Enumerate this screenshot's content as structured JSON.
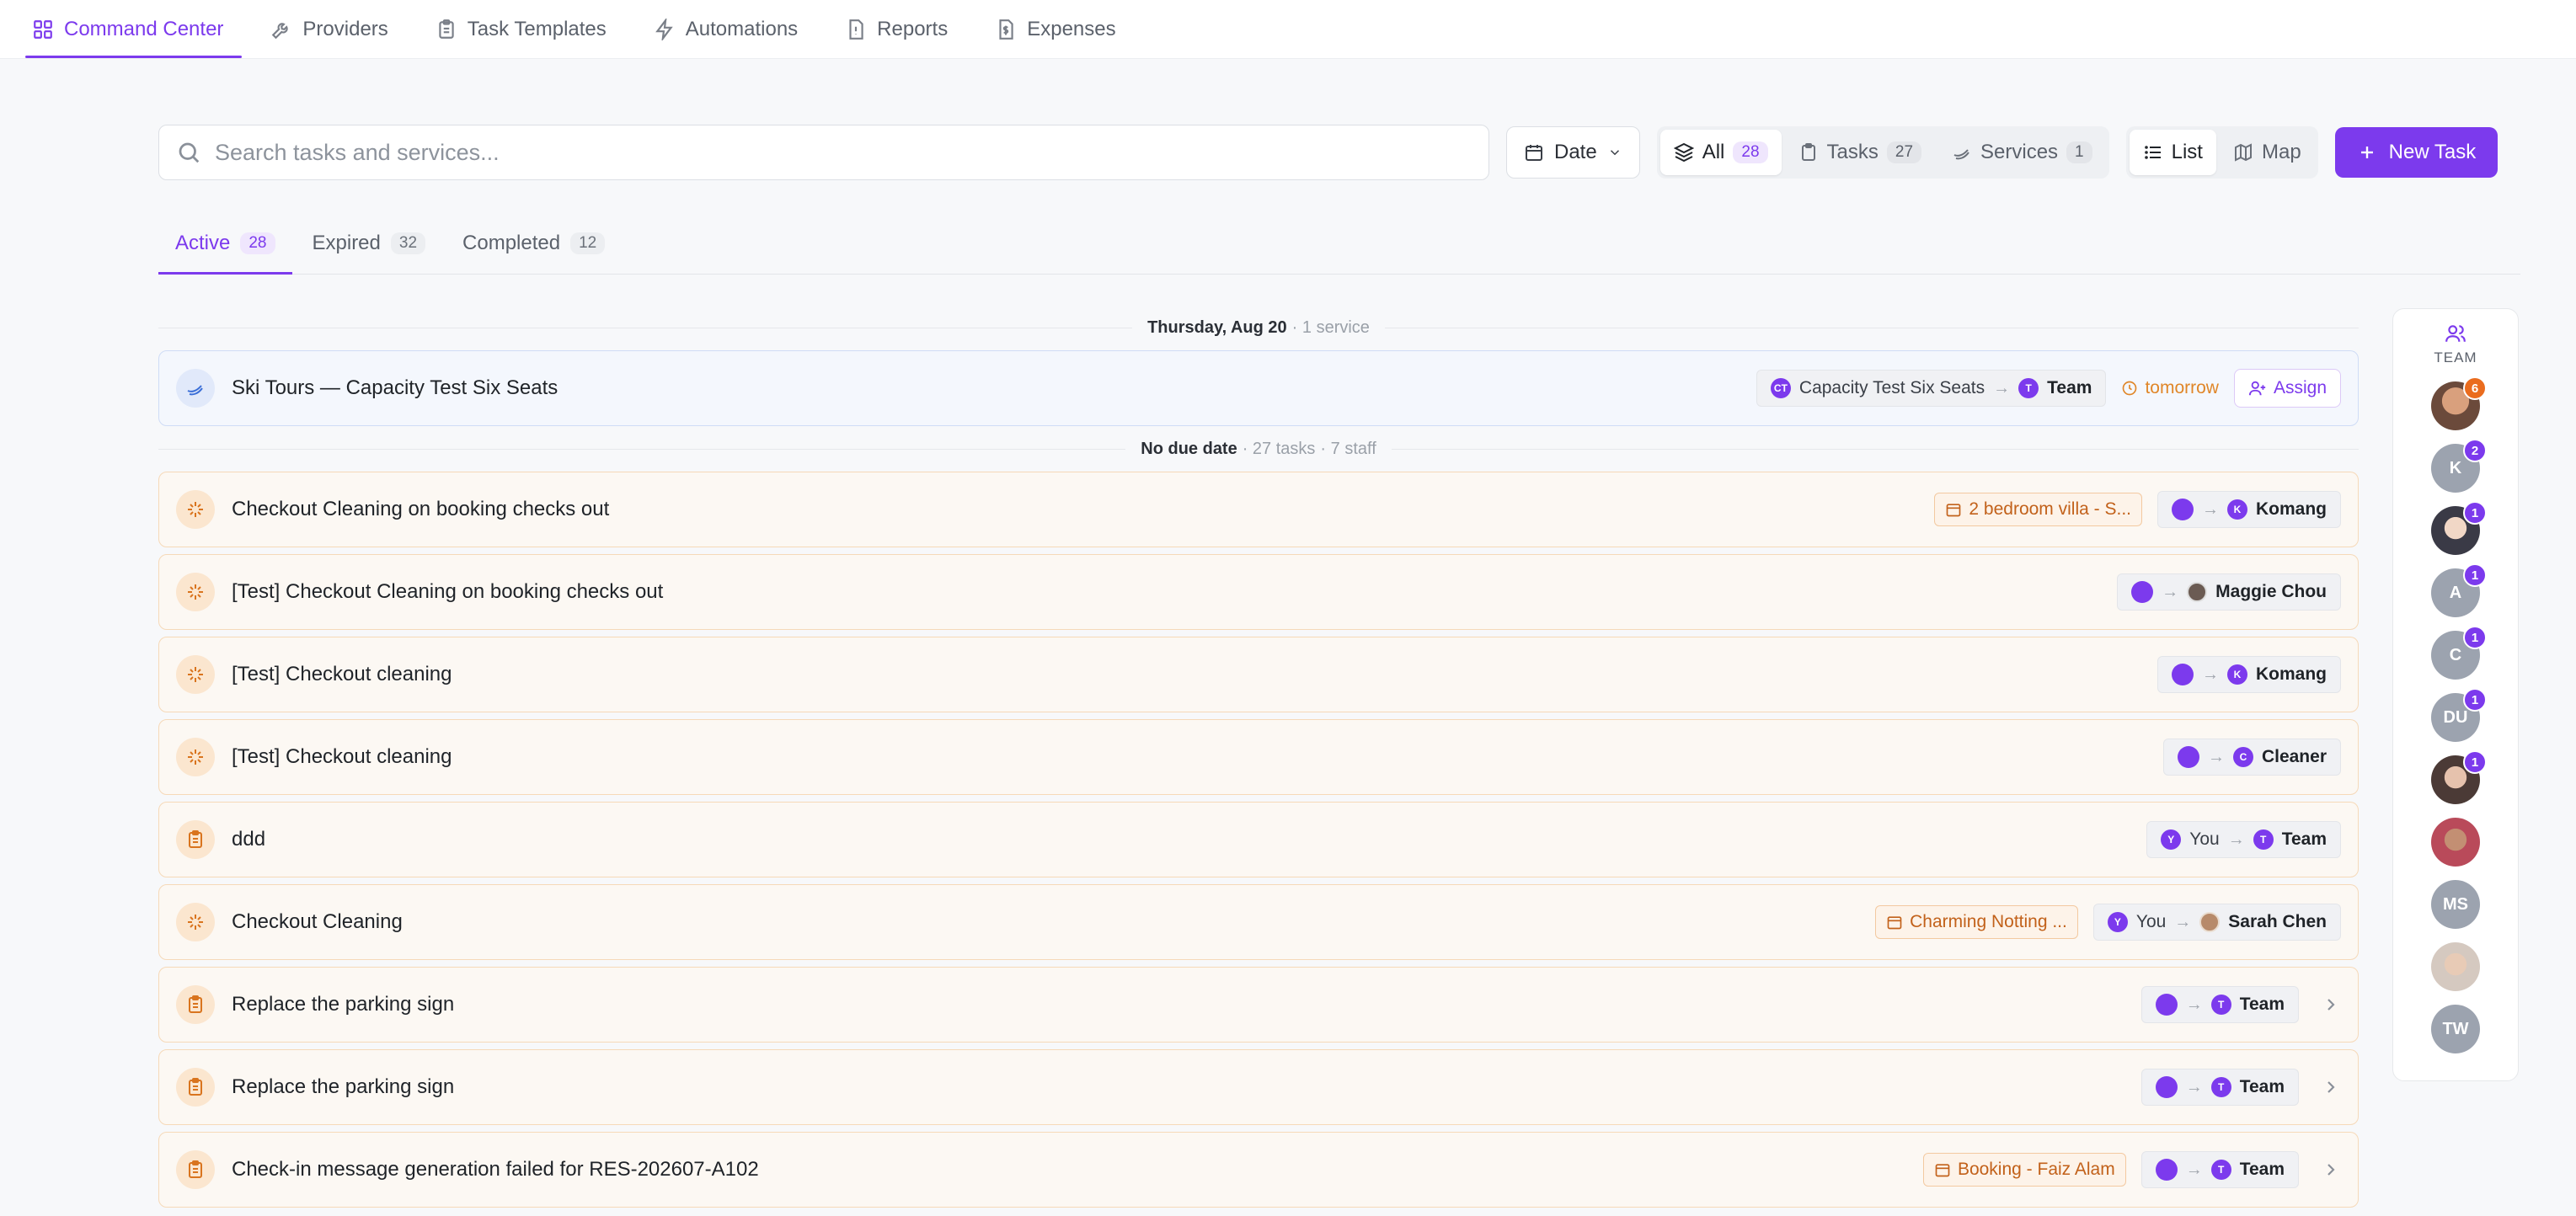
{
  "nav": [
    {
      "label": "Command Center",
      "icon": "grid-icon",
      "active": true
    },
    {
      "label": "Providers",
      "icon": "wrench-icon"
    },
    {
      "label": "Task Templates",
      "icon": "clipboard-icon"
    },
    {
      "label": "Automations",
      "icon": "lightning-icon"
    },
    {
      "label": "Reports",
      "icon": "report-icon"
    },
    {
      "label": "Expenses",
      "icon": "dollar-icon"
    }
  ],
  "toolbar": {
    "search_placeholder": "Search tasks and services...",
    "date_label": "Date",
    "filter": {
      "all": {
        "label": "All",
        "count": "28"
      },
      "tasks": {
        "label": "Tasks",
        "count": "27"
      },
      "services": {
        "label": "Services",
        "count": "1"
      }
    },
    "view": {
      "list": "List",
      "map": "Map"
    },
    "new_task": "New Task"
  },
  "tabs": {
    "active": {
      "label": "Active",
      "count": "28"
    },
    "expired": {
      "label": "Expired",
      "count": "32"
    },
    "completed": {
      "label": "Completed",
      "count": "12"
    }
  },
  "groups": {
    "g1": {
      "date": "Thursday, Aug 20",
      "meta": "· 1 service"
    },
    "g2": {
      "date": "No due date",
      "meta1": "· 27 tasks",
      "meta2": "· 7 staff"
    }
  },
  "service_row": {
    "title": "Ski Tours — Capacity Test Six Seats",
    "from_initials": "CT",
    "from": "Capacity Test Six Seats",
    "to_initial": "T",
    "to": "Team",
    "due": "tomorrow",
    "assign": "Assign"
  },
  "rows": [
    {
      "title": "Checkout Cleaning on booking checks out",
      "location": "2 bedroom villa - S...",
      "to_initial": "K",
      "to": "Komang"
    },
    {
      "title": "[Test] Checkout Cleaning on booking checks out",
      "to": "Maggie Chou"
    },
    {
      "title": "[Test] Checkout cleaning",
      "to_initial": "K",
      "to": "Komang"
    },
    {
      "title": "[Test] Checkout cleaning",
      "to_initial": "C",
      "to": "Cleaner"
    },
    {
      "title": "ddd",
      "from_initial": "Y",
      "from": "You",
      "to_initial": "T",
      "to": "Team"
    },
    {
      "title": "Checkout Cleaning",
      "location": "Charming Notting ...",
      "from_initial": "Y",
      "from": "You",
      "to": "Sarah Chen"
    },
    {
      "title": "Replace the parking sign",
      "to_initial": "T",
      "to": "Team"
    },
    {
      "title": "Replace the parking sign",
      "to_initial": "T",
      "to": "Team"
    },
    {
      "title": "Check-in message generation failed for RES-202607-A102",
      "location": "Booking - Faiz Alam",
      "to_initial": "T",
      "to": "Team"
    }
  ],
  "team": {
    "label": "TEAM",
    "members": [
      {
        "initials": "",
        "badge": "6"
      },
      {
        "initials": "K",
        "badge": "2"
      },
      {
        "initials": "",
        "badge": "1"
      },
      {
        "initials": "A",
        "badge": "1"
      },
      {
        "initials": "C",
        "badge": "1"
      },
      {
        "initials": "DU",
        "badge": "1"
      },
      {
        "initials": "",
        "badge": "1"
      },
      {
        "initials": ""
      },
      {
        "initials": "MS"
      },
      {
        "initials": ""
      },
      {
        "initials": "TW"
      }
    ]
  },
  "colors": {
    "accent": "#7c3aed",
    "warning": "#e08628",
    "task_bg": "#fcf8f3"
  }
}
